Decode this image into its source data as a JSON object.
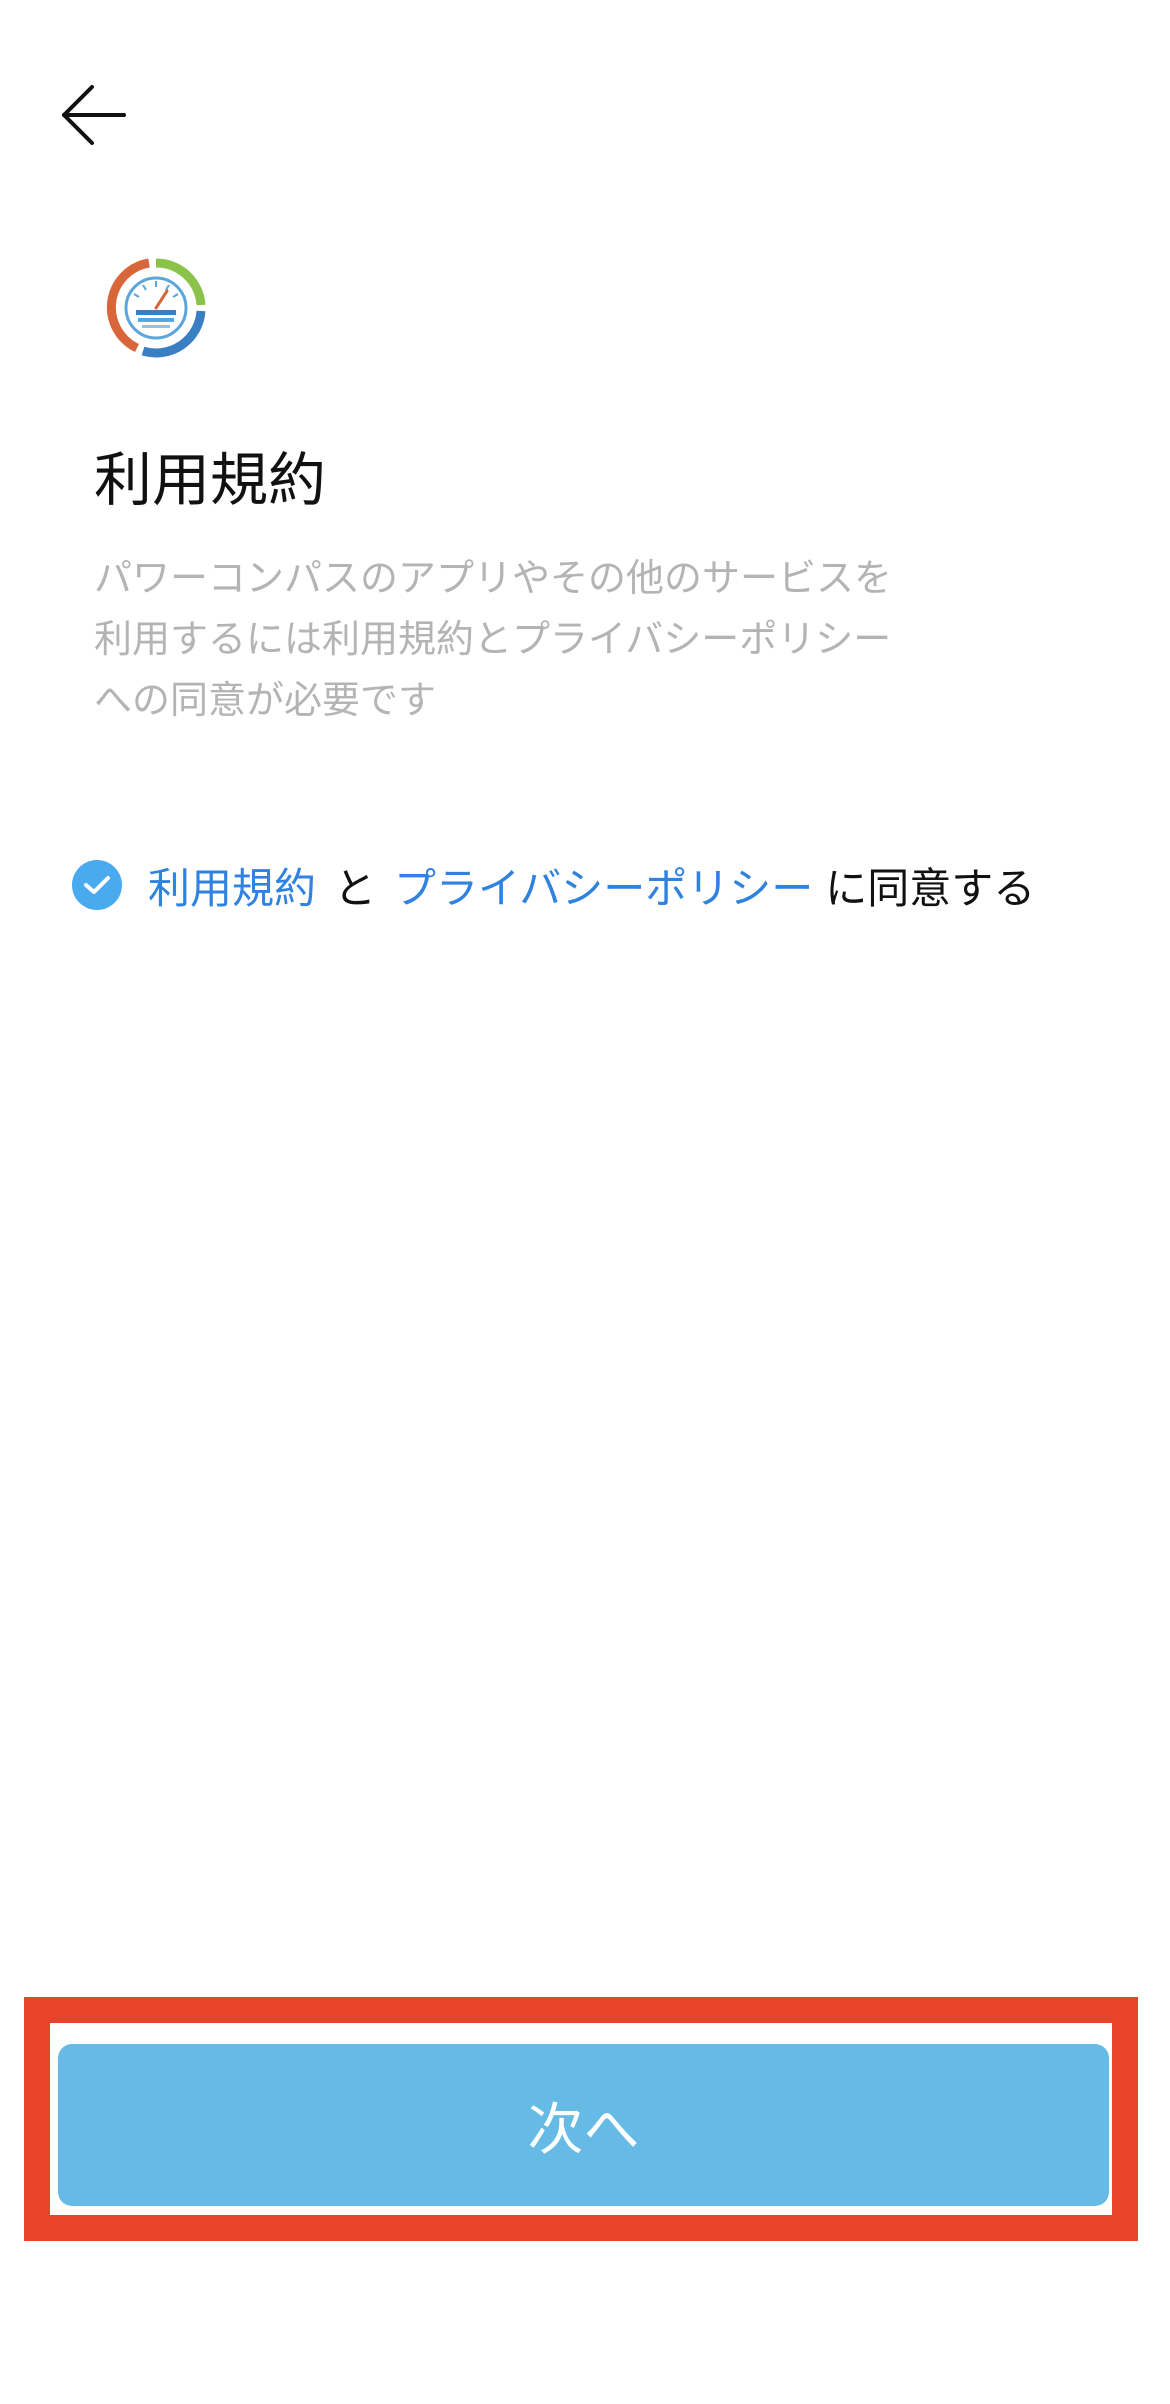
{
  "header": {
    "back_icon": "arrow-left-icon"
  },
  "app": {
    "logo_icon": "power-compass-logo-icon"
  },
  "page": {
    "title": "利用規約",
    "description_lines": [
      "パワーコンパスのアプリやその他のサービスを",
      "利用するには利用規約とプライバシーポリシー",
      "への同意が必要です"
    ]
  },
  "agreement": {
    "checked": true,
    "check_icon": "checkmark-icon",
    "terms_link": "利用規約",
    "connector": "と",
    "privacy_link": "プライバシーポリシー",
    "suffix": "に同意する"
  },
  "footer": {
    "next_label": "次へ"
  },
  "colors": {
    "accent": "#4aaaf0",
    "link": "#2f82e0",
    "button": "#66bbe6",
    "highlight_border": "#e8432b",
    "description_text": "#b4b4b4"
  }
}
